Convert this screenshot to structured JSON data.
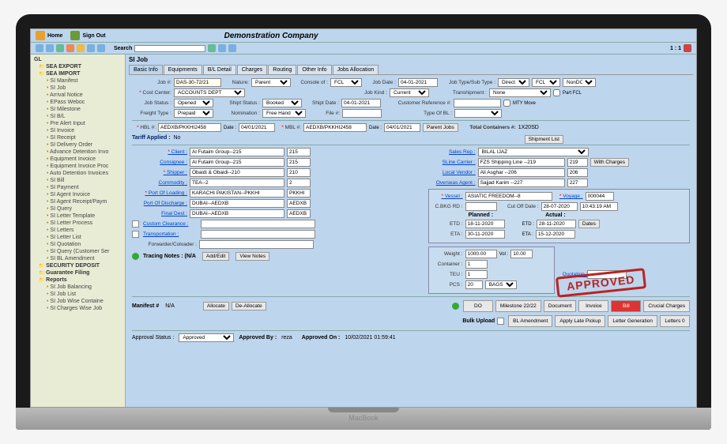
{
  "header": {
    "home": "Home",
    "signout": "Sign Out",
    "title": "Demonstration Company"
  },
  "toolbar": {
    "search_label": "Search",
    "search_placeholder": "",
    "pager": "1 : 1"
  },
  "sidebar": {
    "root": "GL",
    "folders": [
      {
        "label": "SEA EXPORT",
        "items": []
      },
      {
        "label": "SEA IMPORT",
        "items": [
          "SI Manifest",
          "SI Job",
          "Arrival Notice",
          "EPass Weboc",
          "SI Milestone",
          "SI B/L",
          "Pre Alert Input",
          "SI Invoice",
          "SI Receipt",
          "SI Delivery Order",
          "Advance Detention Invo",
          "Equipment Invoice",
          "Equipment Invoice Proc",
          "Auto Detention Invoices",
          "SI Bill",
          "SI Payment",
          "SI Agent Invoice",
          "SI Agent Receipt/Paym",
          "SI Query",
          "SI Letter Template",
          "SI Letter Process",
          "SI Letters",
          "SI Letter List",
          "SI Quotation",
          "SI Query (Customer Ser",
          "SI BL Amendment"
        ]
      },
      {
        "label": "SECURITY DEPOSIT",
        "items": []
      },
      {
        "label": "Guarantee Filing",
        "items": []
      },
      {
        "label": "Reports",
        "items": [
          "SI Job Balancing",
          "SI Job List",
          "SI Job Wise Containe",
          "SI Charges Wise Job"
        ]
      }
    ]
  },
  "content": {
    "title": "SI Job",
    "tabs": [
      "Basic Info",
      "Equipments",
      "B/L Detail",
      "Charges",
      "Routing",
      "Other Info",
      "Jobs Allocation"
    ],
    "active_tab": 0
  },
  "form": {
    "job_no_lbl": "Job #:",
    "job_no": "DAS-30-72/21",
    "nature_lbl": "Nature:",
    "nature": "Parent",
    "console_lbl": "Console of :",
    "console": "FCL",
    "job_date_lbl": "Job Date :",
    "job_date": "04-01-2021",
    "job_type_lbl": "Job Type/Sub Type :",
    "job_type": "Direct",
    "job_sub": "FCL",
    "nondc": "NonDC",
    "cost_center_lbl": "Cost Center:",
    "cost_center": "ACCOUNTS DEPT",
    "job_kind_lbl": "Job Kind :",
    "job_kind": "Current",
    "transhipment_lbl": "Transhipment :",
    "transhipment": "None",
    "partfcl": "Part FCL",
    "mtymove": "MTY Move",
    "job_status_lbl": "Job Status :",
    "job_status": "Opened",
    "shipt_status_lbl": "Shipt Status :",
    "shipt_status": "Booked",
    "shipt_date_lbl": "Shipt Date :",
    "shipt_date": "04-01-2021",
    "cust_ref_lbl": "Customer Reference #:",
    "cust_ref": "",
    "freight_type_lbl": "Freight Type :",
    "freight_type": "Prepaid",
    "nomination_lbl": "Nomination :",
    "nomination": "Free Hand",
    "file_lbl": "File #:",
    "file": "",
    "type_bl_lbl": "Type Of BL :",
    "type_bl": "",
    "hbl_lbl": "HBL #:",
    "hbl": "AEDXB/PKKHI2458",
    "hbl_date": "04/01/2021",
    "mbl_lbl": "MBL #:",
    "mbl": "AEDXB/PKKHI2458",
    "mbl_date": "04/01/2021",
    "parent_btn": "Parent Jobs",
    "total_cont_lbl": "Total Containers #:",
    "total_cont": "1X20SD",
    "shipment_btn": "Shipment List",
    "tariff_lbl": "Tariff Applied :",
    "tariff_val": "No",
    "client_lbl": "Client :",
    "client": "Al Futaim Group--215",
    "client_code": "215",
    "consignee_lbl": "Consignee :",
    "consignee": "Al Futaim Group--215",
    "consignee_code": "215",
    "shipper_lbl": "Shipper :",
    "shipper": "Obaidi & Obaidi--210",
    "shipper_code": "210",
    "commodity_lbl": "Commodity :",
    "commodity": "TEA--2",
    "commodity_code": "2",
    "pol_lbl": "Port Of Loading :",
    "pol": "KARACHI PAKISTAN--PKKHI",
    "pol_code": "PKKHI",
    "pod_lbl": "Port Of Discharge :",
    "pod": "DUBAI--AEDXB",
    "pod_code": "AEDXB",
    "final_dest_lbl": "Final Dest :",
    "final_dest": "DUBAI--AEDXB",
    "final_dest_code": "AEDXB",
    "custom_lbl": "Custom Clearance :",
    "transport_lbl": "Transportation :",
    "forwarder_lbl": "Forwarder/Coloader :",
    "sales_rep_lbl": "Sales Rep :",
    "sales_rep": "BILAL IJAZ",
    "sline_lbl": "SLine Carrier :",
    "sline": "FZS Shipping Line --219",
    "sline_code": "219",
    "with_charges": "With Charges",
    "local_vendor_lbl": "Local Vendor :",
    "local_vendor": "Ali Asghar --206",
    "local_vendor_code": "206",
    "overseas_lbl": "Overseas Agent :",
    "overseas": "Sajjad Karim --227",
    "overseas_code": "227",
    "vessel_lbl": "Vessel :",
    "vessel": "ASIATIC FREEDOM--8",
    "voyage_lbl": "Voyage :",
    "voyage": "000044",
    "cbkg_lbl": "C.BKG RD :",
    "cbkg": "",
    "cutoff_lbl": "Cut Off Date :",
    "cutoff_date": "28-07-2020",
    "cutoff_time": "10:43:19 AM",
    "planned": "Planned :",
    "actual": "Actual :",
    "etd_lbl": "ETD :",
    "eta_lbl": "ETA :",
    "etd_p": "18-11-2020",
    "eta_p": "30-11-2020",
    "etd_a": "28-11-2020",
    "eta_a": "15-12-2020",
    "dates_btn": "Dates",
    "weight_lbl": "Weight :",
    "weight": "1000.00",
    "vol_lbl": "Vol :",
    "vol": "10.00",
    "container_lbl": "Container :",
    "container": "1",
    "teu_lbl": "TEU :",
    "teu": "1",
    "pcs_lbl": "PCS :",
    "pcs": "20",
    "pcs_unit": "BAGS",
    "quotation_lbl": "Quotation :",
    "tracing_lbl": "Tracing Notes : (N/A",
    "add_edit": "Add/Edit",
    "view_notes": "View Notes",
    "manifest_lbl": "Manifest #",
    "manifest_val": "N/A",
    "allocate": "Allocate",
    "deallocate": "De-Allocate",
    "do_btn": "DO",
    "milestone_btn": "Milestone 22/22",
    "document_btn": "Document",
    "invoice_btn": "Invoice",
    "bill_btn": "Bill",
    "crucial_btn": "Crucial Charges",
    "bulk_lbl": "Bulk Upload",
    "bl_amend": "BL Amendment",
    "apply_late": "Apply Late Pickup",
    "letter_gen": "Letter Generation",
    "letters_btn": "Letters 0",
    "approval_status_lbl": "Approval Status :",
    "approval_status": "Approved",
    "approved_by_lbl": "Approved By :",
    "approved_by": "reza",
    "approved_on_lbl": "Approved On :",
    "approved_on": "10/02/2021 01:59:41"
  },
  "stamp": "APPROVED"
}
